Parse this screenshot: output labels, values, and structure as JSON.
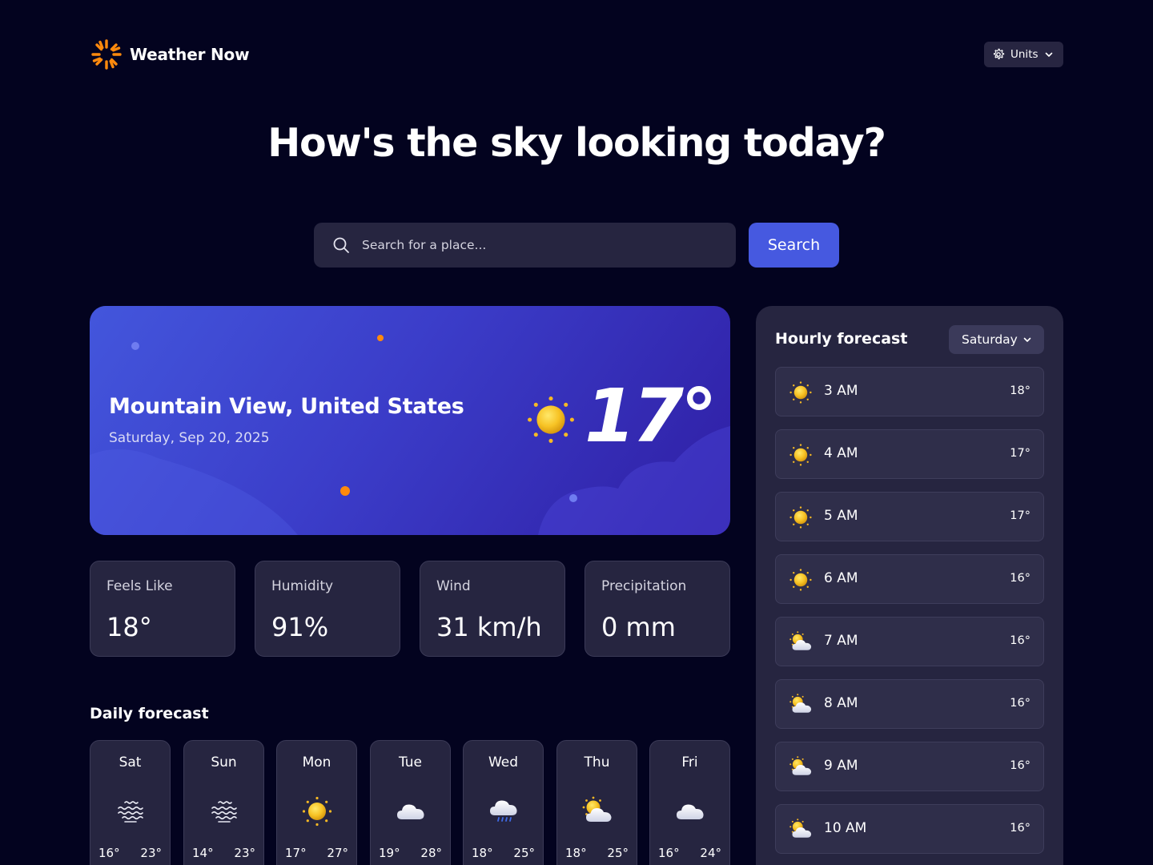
{
  "header": {
    "app_name": "Weather Now",
    "units_label": "Units",
    "logo_icon": "sun-logo-icon",
    "units_icon": "gear-icon"
  },
  "headline": "How's the sky looking today?",
  "search": {
    "placeholder": "Search for a place...",
    "button_label": "Search",
    "icon": "search-icon"
  },
  "current": {
    "location": "Mountain View, United States",
    "date": "Saturday, Sep 20, 2025",
    "temperature": "17°",
    "icon": "sunny-icon"
  },
  "stats": [
    {
      "label": "Feels Like",
      "value": "18°"
    },
    {
      "label": "Humidity",
      "value": "91%"
    },
    {
      "label": "Wind",
      "value": "31 km/h"
    },
    {
      "label": "Precipitation",
      "value": "0 mm"
    }
  ],
  "daily": {
    "title": "Daily forecast",
    "days": [
      {
        "name": "Sat",
        "low": "16°",
        "high": "23°",
        "icon": "fog-icon"
      },
      {
        "name": "Sun",
        "low": "14°",
        "high": "23°",
        "icon": "fog-icon"
      },
      {
        "name": "Mon",
        "low": "17°",
        "high": "27°",
        "icon": "sunny-icon"
      },
      {
        "name": "Tue",
        "low": "19°",
        "high": "28°",
        "icon": "cloudy-icon"
      },
      {
        "name": "Wed",
        "low": "18°",
        "high": "25°",
        "icon": "drizzle-icon"
      },
      {
        "name": "Thu",
        "low": "18°",
        "high": "25°",
        "icon": "partly-cloudy-icon"
      },
      {
        "name": "Fri",
        "low": "16°",
        "high": "24°",
        "icon": "cloudy-icon"
      }
    ]
  },
  "hourly": {
    "title": "Hourly forecast",
    "selected_day": "Saturday",
    "hours": [
      {
        "time": "3 AM",
        "temp": "18°",
        "icon": "sunny-icon"
      },
      {
        "time": "4 AM",
        "temp": "17°",
        "icon": "sunny-icon"
      },
      {
        "time": "5 AM",
        "temp": "17°",
        "icon": "sunny-icon"
      },
      {
        "time": "6 AM",
        "temp": "16°",
        "icon": "sunny-icon"
      },
      {
        "time": "7 AM",
        "temp": "16°",
        "icon": "partly-cloudy-icon"
      },
      {
        "time": "8 AM",
        "temp": "16°",
        "icon": "partly-cloudy-icon"
      },
      {
        "time": "9 AM",
        "temp": "16°",
        "icon": "partly-cloudy-icon"
      },
      {
        "time": "10 AM",
        "temp": "16°",
        "icon": "partly-cloudy-icon"
      }
    ]
  },
  "colors": {
    "background": "#03031f",
    "card": "#262540",
    "accent": "#4659e0",
    "sun": "#f7b924",
    "logo": "#ff8a0d"
  }
}
